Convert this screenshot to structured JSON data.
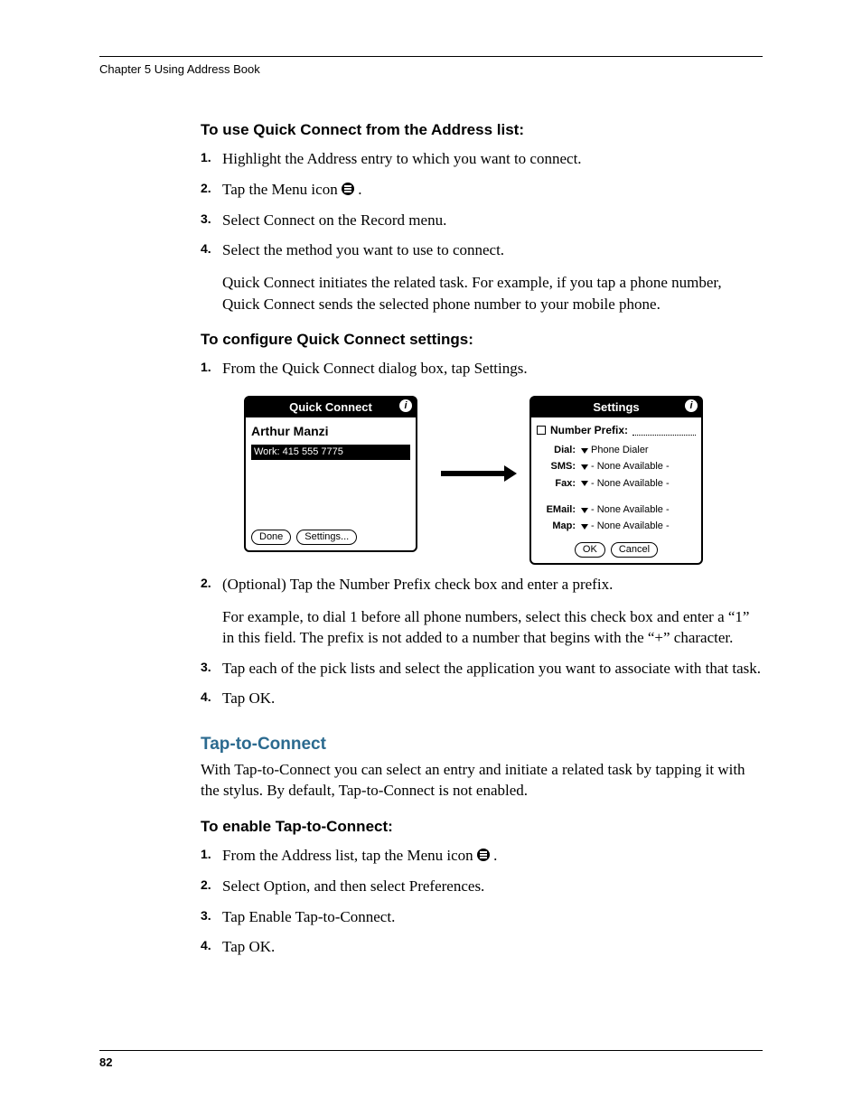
{
  "header": {
    "running": "Chapter 5   Using Address Book"
  },
  "sec1": {
    "heading": "To use Quick Connect from the Address list:",
    "steps": [
      "Highlight the Address entry to which you want to connect.",
      "Tap the Menu icon",
      "Select Connect on the Record menu.",
      "Select the method you want to use to connect."
    ],
    "follow": "Quick Connect initiates the related task. For example, if you tap a phone number, Quick Connect sends the selected phone number to your mobile phone."
  },
  "sec2": {
    "heading": "To configure Quick Connect settings:",
    "step1": "From the Quick Connect dialog box, tap Settings.",
    "step2": "(Optional) Tap the Number Prefix check box and enter a prefix.",
    "step2_follow": "For example, to dial 1 before all phone numbers, select this check box and enter a “1” in this field. The prefix is not added to a number that begins with the “+” character.",
    "step3": "Tap each of the pick lists and select the application you want to associate with that task.",
    "step4": "Tap OK."
  },
  "screens": {
    "qc": {
      "title": "Quick Connect",
      "name": "Arthur Manzi",
      "entry": "Work: 415 555 7775",
      "done": "Done",
      "settings": "Settings..."
    },
    "set": {
      "title": "Settings",
      "np_label": "Number Prefix:",
      "rows": [
        {
          "label": "Dial:",
          "value": "Phone Dialer"
        },
        {
          "label": "SMS:",
          "value": "- None Available -"
        },
        {
          "label": "Fax:",
          "value": "- None Available -"
        },
        {
          "label": "EMail:",
          "value": "- None Available -"
        },
        {
          "label": "Map:",
          "value": "- None Available -"
        }
      ],
      "ok": "OK",
      "cancel": "Cancel"
    }
  },
  "tap": {
    "heading": "Tap-to-Connect",
    "intro": "With Tap-to-Connect you can select an entry and initiate a related task by tapping it with the stylus. By default, Tap-to-Connect is not enabled.",
    "subheading": "To enable Tap-to-Connect:",
    "steps": [
      "From the Address list, tap the Menu icon",
      "Select Option, and then select Preferences.",
      "Tap Enable Tap-to-Connect.",
      "Tap OK."
    ]
  },
  "page": "82"
}
